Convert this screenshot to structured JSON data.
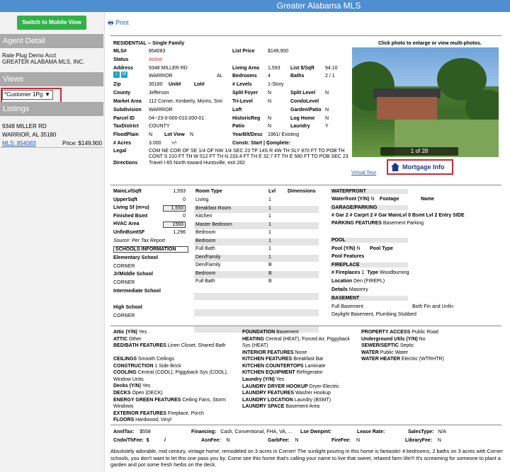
{
  "header": {
    "title": "Greater Alabama MLS"
  },
  "sidebar": {
    "mobile_button": "Switch to Mobile View",
    "agent_heading": "Agent Detail",
    "agent_line1": "Rate Plug Demo Acct",
    "agent_line2": "GREATER ALABAMA MLS, INC.",
    "views_heading": "Views",
    "view_select": "*Customer 1Pg",
    "listings_heading": "Listings",
    "listing_address": "9348 MILLER RD",
    "listing_city": "WARRIOR, AL 35180",
    "listing_mls": "MLS: 854083",
    "listing_price": "Price: $149,900"
  },
  "toolbar": {
    "print_label": "Print"
  },
  "listing": {
    "type_line": "RESIDENTIAL -- Single Family",
    "photo_caption": "Click photo to enlarge or view multi-photos.",
    "photo_counter": "1 of 28",
    "mortgage_label": "Mortgage Info",
    "virtual_tour": "Virtual Tour",
    "col1": [
      {
        "l": "MLS#",
        "v": "854083"
      },
      {
        "l": "Status",
        "v": "Active"
      },
      {
        "l": "Address",
        "v": "9348 MILLER RD"
      },
      {
        "l": "",
        "v": "WARRIOR"
      },
      {
        "l": "Zip",
        "v": "35180"
      },
      {
        "l": "County",
        "v": "Jefferson"
      },
      {
        "l": "Market Area",
        "v": "112 Corner, Kimberly, Morris, Smi"
      },
      {
        "l": "Subdivision",
        "v": "WARRIOR"
      },
      {
        "l": "Parcel ID",
        "v": "04--23-0-000-010.000-01"
      },
      {
        "l": "TaxDistrict",
        "v": "COUNTY"
      },
      {
        "l": "FloodPlain",
        "v": "N"
      },
      {
        "l": "# Acres",
        "v": "3.000"
      },
      {
        "l": "Legal",
        "v": "COM NE COR OF SE 1/4 OF NW 1/4 SEC 23 TP 14S R 4W TH SLY 870 FT TO POB TH CONT S 210 FT TH W 512 FT TH N 233.4 FT TH E 32.7 FT TH E 580 FT TO POB SEC 23 TWP 14S RNG"
      },
      {
        "l": "Directions",
        "v": "Travel I-65 North toward Huntsville, exit 282"
      }
    ],
    "state": "AL",
    "unit_label": "Unit#",
    "lot_label": "Lot#",
    "lotview_label": "Lot View",
    "lotview": "N",
    "acres_extra": "+/-",
    "col2": [
      {
        "l": "List Price",
        "v": "$149,900"
      },
      {
        "l": "Living Area",
        "v": "1,593"
      },
      {
        "l": "Bedrooms",
        "v": "4"
      },
      {
        "l": "# Levels",
        "v": "1-Story"
      },
      {
        "l": "Split Foyer",
        "v": "N"
      },
      {
        "l": "Tri-Level",
        "v": "N"
      },
      {
        "l": "Loft",
        "v": ""
      },
      {
        "l": "HistoricReg",
        "v": "N"
      },
      {
        "l": "Patio",
        "v": "N"
      },
      {
        "l": "YearBlt/Desc",
        "v": "1961/ Existing"
      },
      {
        "l": "Constr. Start | Complete:",
        "v": "|"
      }
    ],
    "col3": [
      {
        "l": "List $/Sqft",
        "v": "94.10"
      },
      {
        "l": "Baths",
        "v": "2 / 1"
      },
      {
        "l": "Split Level",
        "v": "N"
      },
      {
        "l": "CondoLevel",
        "v": ""
      },
      {
        "l": "Garden/Patio",
        "v": "N"
      },
      {
        "l": "Log Home",
        "v": "N"
      },
      {
        "l": "Laundry",
        "v": "Y"
      }
    ]
  },
  "sqft": {
    "rows": [
      {
        "l": "MainLvlSqft",
        "v": "1,593"
      },
      {
        "l": "UpperSqft",
        "v": "0"
      },
      {
        "l": "Living Sf (m+u)",
        "v": "1,593"
      },
      {
        "l": "Finished Bsmt",
        "v": "0"
      },
      {
        "l": "HVAC Area",
        "v": "1593"
      },
      {
        "l": "UnfinBsmtSF",
        "v": "1,296"
      }
    ],
    "source": "Source:",
    "source_val": "Per Tax Report",
    "schools_heading": "SCHOOLS INFORMATION",
    "elementary_label": "Elementary School",
    "elementary": "CORNER",
    "jrmiddle_label": "Jr/Middle School",
    "jrmiddle": "CORNER",
    "intermediate_label": "Intermediate School",
    "high_label": "High School",
    "high": "CORNER"
  },
  "rooms": {
    "headers": [
      "Room Type",
      "Lvl",
      "Dimensions"
    ],
    "rows": [
      {
        "room": "Living",
        "lvl": "1"
      },
      {
        "room": "Breakfast Room",
        "lvl": "1"
      },
      {
        "room": "Kitchen",
        "lvl": "1"
      },
      {
        "room": "Master Bedroom",
        "lvl": "1"
      },
      {
        "room": "Bedroom",
        "lvl": "1"
      },
      {
        "room": "Bedroom",
        "lvl": "1"
      },
      {
        "room": "Full Bath",
        "lvl": "1"
      },
      {
        "room": "Den/Family",
        "lvl": "1"
      },
      {
        "room": "Den/Family",
        "lvl": "B"
      },
      {
        "room": "Bedroom",
        "lvl": "B"
      },
      {
        "room": "Full Bath",
        "lvl": "B"
      }
    ]
  },
  "right": {
    "waterfront_h": "WATERFRONT",
    "waterfront_yn": "Waterfront (Y/N)",
    "waterfront_yn_v": "N",
    "footage": "Footage",
    "name": "Name",
    "garage_h": "GARAGE/PARKING",
    "garage_line": "# Gar  2  # Carprt  2  # Gar MainLvl  0  Bsmt Lvl  2  Entry SIDE",
    "parking_features": "PARKING FEATURES",
    "parking_features_v": "Basement Parking",
    "pool_h": "POOL",
    "pool_yn": "Pool (Y/N)",
    "pool_yn_v": "N",
    "pool_type": "Pool Type",
    "pool_features": "Pool Features",
    "fireplace_h": "FIREPLACE",
    "fireplaces": "# Fireplaces",
    "fireplaces_v": "1",
    "fp_type": "Type",
    "fp_type_v": "Woodburning",
    "location": "Location",
    "location_v": "Den (FIREPL)",
    "details": "Details",
    "details_v": "Masonry",
    "basement_h": "BASEMENT",
    "basement_v1": "Full Basement",
    "basement_v2": "Both Fin and Unfin",
    "basement_v3": "Daylight Basement, Plumbing Stubbed"
  },
  "features": {
    "colA": [
      {
        "l": "Attic (Y/N)",
        "v": "Yes"
      },
      {
        "l": "ATTIC",
        "v": "Other"
      },
      {
        "l": "BED/BATH FEATURES",
        "v": "Linen Closet, Shared Bath"
      },
      {
        "l": "CEILINGS",
        "v": "Smooth Ceilings"
      },
      {
        "l": "CONSTRUCTION",
        "v": "1 Side Brick"
      },
      {
        "l": "COOLING",
        "v": "Central (COOL), Piggyback Sys (COOL), Window Units"
      },
      {
        "l": "Decks (Y/N)",
        "v": "Yes"
      },
      {
        "l": "DECKS",
        "v": "Open (DECK)"
      },
      {
        "l": "ENERGY GREEN FEATURES",
        "v": "Ceiling Fans, Storm Windows"
      },
      {
        "l": "EXTERIOR FEATURES",
        "v": "Fireplace, Porch"
      },
      {
        "l": "FLOORS",
        "v": "Hardwood, Vinyl"
      }
    ],
    "colB": [
      {
        "l": "FOUNDATION",
        "v": "Basement"
      },
      {
        "l": "HEATING",
        "v": "Central (HEAT), Forced Air, Piggyback Sys (HEAT)"
      },
      {
        "l": "INTERIOR FEATURES",
        "v": "None"
      },
      {
        "l": "KITCHEN FEATURES",
        "v": "Breakfast Bar"
      },
      {
        "l": "KITCHEN COUNTERTOPS",
        "v": "Laminate"
      },
      {
        "l": "KITCHEN EQUIPMENT",
        "v": "Refrigerator"
      },
      {
        "l": "Laundry (Y/N)",
        "v": "Yes"
      },
      {
        "l": "LAUNDRY DRYER HOOKUP",
        "v": "Dryer-Electric"
      },
      {
        "l": "LAUNDRY FEATURES",
        "v": "Washer Hookup"
      },
      {
        "l": "LAUNDRY LOCATION",
        "v": "Laundry (BSMT)"
      },
      {
        "l": "LAUNDRY SPACE",
        "v": "Basement Area"
      }
    ],
    "colC": [
      {
        "l": "PROPERTY ACCESS",
        "v": "Public Road"
      },
      {
        "l": "Underground Utils (Y/N)",
        "v": "No"
      },
      {
        "l": "SEWER/SEPTIC",
        "v": "Septic"
      },
      {
        "l": "WATER",
        "v": "Public Water"
      },
      {
        "l": "WATER HEATER",
        "v": "Electric (WTRHTR)"
      }
    ]
  },
  "financial": {
    "annltax_l": "AnnlTax:",
    "annltax_v": "$558",
    "financing_l": "Financing:",
    "financing_v": "Cash, Conventional, FHA, VA, ...",
    "lse_l": "Lse Dwnpmt:",
    "lease_l": "Lease Rate:",
    "salestype_l": "SalesType:",
    "salestype_v": "N/A",
    "cndo_l": "Cndo/ThFee:",
    "cndo_v": "$",
    "cndo_slash": "/",
    "asnfee_l": "AsnFee:",
    "asnfee_v": "N",
    "garbfee_l": "GarbFee:",
    "garbfee_v": "N",
    "firefee_l": "FireFee:",
    "firefee_v": "N",
    "libfee_l": "LibraryFee:",
    "libfee_v": "N"
  },
  "description": "Absolutely adorable, mid century, vintage home, remodeled on 3 acres in Corner! The sunlight pouring in this home is fantastic! 4 bedrooms, 2 baths on 3 acres with Corner schools, you don't want to let this one pass you by. Come see this home that's calling your name to live that sweet, relaxed farm life!!! It's screaming for someone to plant a garden and pot some fresh herbs on the deck."
}
